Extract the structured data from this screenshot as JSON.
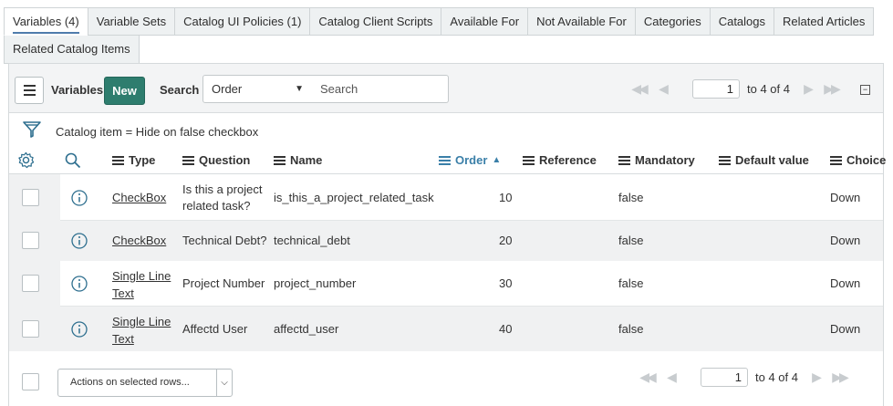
{
  "tabs_row1": [
    "Variables (4)",
    "Variable Sets",
    "Catalog UI Policies (1)",
    "Catalog Client Scripts",
    "Available For",
    "Not Available For",
    "Categories",
    "Catalogs",
    "Related Articles"
  ],
  "tabs_row2": [
    "Related Catalog Items"
  ],
  "toolbar": {
    "title": "Variables",
    "new_label": "New",
    "search_label": "Search",
    "search_field": "Order",
    "search_placeholder": "Search",
    "page_value": "1",
    "page_text": "to 4 of 4"
  },
  "filter": {
    "text": "Catalog item = Hide on false checkbox"
  },
  "columns": [
    "Type",
    "Question",
    "Name",
    "Order",
    "Reference",
    "Mandatory",
    "Default value",
    "Choice"
  ],
  "sorted_column": "Order",
  "rows": [
    {
      "type": "CheckBox",
      "question": "Is this a project related task?",
      "name": "is_this_a_project_related_task",
      "order": "10",
      "reference": "",
      "mandatory": "false",
      "default_value": "",
      "choice": "Down"
    },
    {
      "type": "CheckBox",
      "question": "Technical Debt?",
      "name": "technical_debt",
      "order": "20",
      "reference": "",
      "mandatory": "false",
      "default_value": "",
      "choice": "Down"
    },
    {
      "type": "Single Line Text",
      "question": "Project Number",
      "name": "project_number",
      "order": "30",
      "reference": "",
      "mandatory": "false",
      "default_value": "",
      "choice": "Down"
    },
    {
      "type": "Single Line Text",
      "question": "Affectd User",
      "name": "affectd_user",
      "order": "40",
      "reference": "",
      "mandatory": "false",
      "default_value": "",
      "choice": "Down"
    }
  ],
  "footer": {
    "actions_placeholder": "Actions on selected rows...",
    "page_value": "1",
    "page_text": "to 4 of 4"
  }
}
